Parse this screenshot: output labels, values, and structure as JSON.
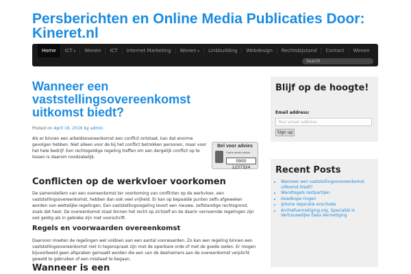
{
  "header": {
    "site_title": "Persberichten en Online Media Publicaties Door: Kineret.nl"
  },
  "nav": {
    "items": [
      {
        "label": "Home",
        "caret": ""
      },
      {
        "label": "ICT",
        "caret": "▾"
      },
      {
        "label": "Wonen",
        "caret": ""
      },
      {
        "label": "ICT",
        "caret": ""
      },
      {
        "label": "Internet Marketing",
        "caret": ""
      },
      {
        "label": "Wonen",
        "caret": "▾"
      },
      {
        "label": "Linkbuilding",
        "caret": ""
      },
      {
        "label": "Webdesign",
        "caret": ""
      },
      {
        "label": "Rechtsbijstand",
        "caret": ""
      },
      {
        "label": "Contact",
        "caret": ""
      },
      {
        "label": "Wonen",
        "caret": ""
      }
    ],
    "search_placeholder": "Search"
  },
  "article": {
    "title": "Wanneer een vaststellingsovereenkomst uitkomst biedt?",
    "meta": {
      "posted_on": "Posted on",
      "date": "April 16, 2016",
      "by": "by",
      "author": "admin"
    },
    "intro": "Als er binnen een arbeidsovereenkomst een conflict ontstaat, kan dat enorme gevolgen hebben. Niet alleen voor de bij het conflict betrokken personen, maar voor het hele bedrijf. Een rechtsgeldige regeling treffen om een dergelijk conflict op te lossen is daarom noodzakelijk.",
    "ad": {
      "title": "Bel voor advies",
      "subtitle": "Gratis eerste advies",
      "phone": "0900 1237324",
      "icon": "phone-icon"
    },
    "h2_conflicts": "Conflicten op de werkvloer voorkomen",
    "p_conflicts": "De samenstellers van een overeenkomst ter voorkoming van conflicten op de werkvloer, een vaststellingsovereenkomst, hebben dan ook veel vrijheid. Er kan op bepaalde punten zelfs afgeweken worden van wettelijke regelingen. Een vaststellingsregeling levert een nieuwe, zelfstandige rechtsgrond, zoals dat heet. De overeenkomst staat binnen het recht op zichzelf en de daarin vernoemde regelingen zijn ook geldig als in gebreke zijn met voorschrift.",
    "h3_rules": "Regels en voorwaarden overeenkomst",
    "p_rules": "Daarvoor moeten de regelingen wel voldoen aan een aantal voorwaarden. Zo kan een regeling binnen een vaststellingsovereenkomst niet in tegenspraak zijn met de openbare orde of met de goede zeden. Er mogen bijvoorbeeld geen afspraken gemaakt worden die een van de deelnemers aan de overeenkomst verplicht geweld te gebruiken of een misdaad te begaan.",
    "h2_when": "Wanneer is een"
  },
  "sidebar": {
    "subscribe": {
      "title": "Blijf op de hoogte!",
      "email_label": "Email address:",
      "email_placeholder": "Your email address",
      "button_label": "Sign up"
    },
    "recent": {
      "title": "Recent Posts",
      "items": [
        "Wanneer een vaststellingsovereenkomst uitkomst biedt?",
        "Wandtegels restpartijen",
        "Goedkope ringen",
        "iphone reparatie enschede",
        "Archiefvernietiging.org, Specialist in Vertrouwelijke Data Vernietiging"
      ]
    }
  },
  "colors": {
    "accent": "#1b8be0",
    "nav_bg": "#1a1a1a",
    "sidebar_bg": "#efefef"
  }
}
